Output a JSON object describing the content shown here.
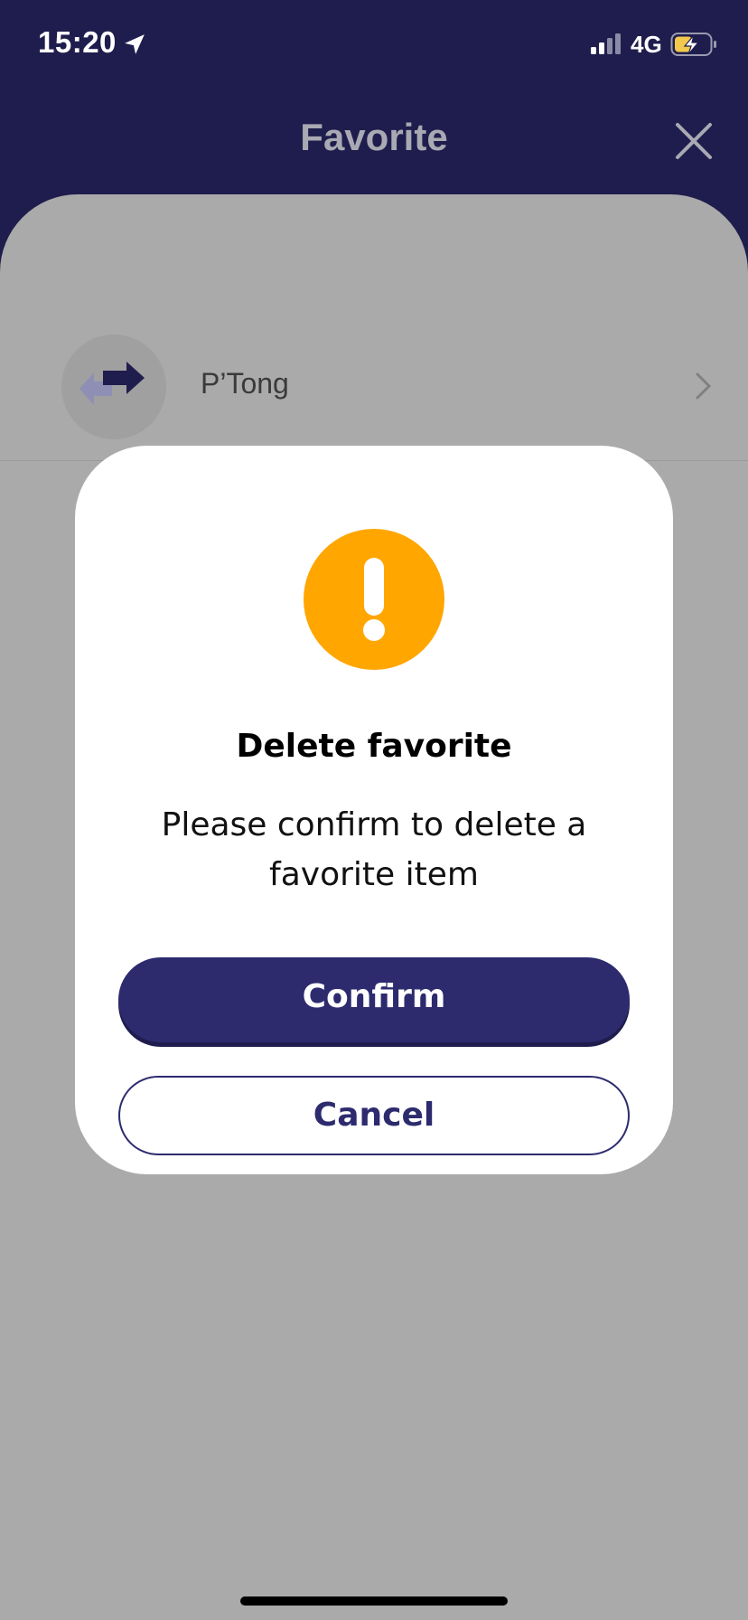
{
  "status_bar": {
    "time": "15:20",
    "network": "4G",
    "location_icon": "location-arrow-icon",
    "signal_icon": "cellular-signal-icon",
    "battery_icon": "battery-charging-icon"
  },
  "header": {
    "title": "Favorite",
    "close_icon": "close-icon"
  },
  "favorites": {
    "items": [
      {
        "name": "P’Tong",
        "icon": "transfer-arrows-icon"
      }
    ]
  },
  "dialog": {
    "icon": "warning-exclamation-icon",
    "title": "Delete favorite",
    "message": "Please confirm to delete a favorite item",
    "confirm_label": "Confirm",
    "cancel_label": "Cancel"
  },
  "colors": {
    "header_bg": "#1f1d4d",
    "dim_bg": "#aaaaaa",
    "accent": "#2d2b6e",
    "warning": "#ffa600"
  }
}
